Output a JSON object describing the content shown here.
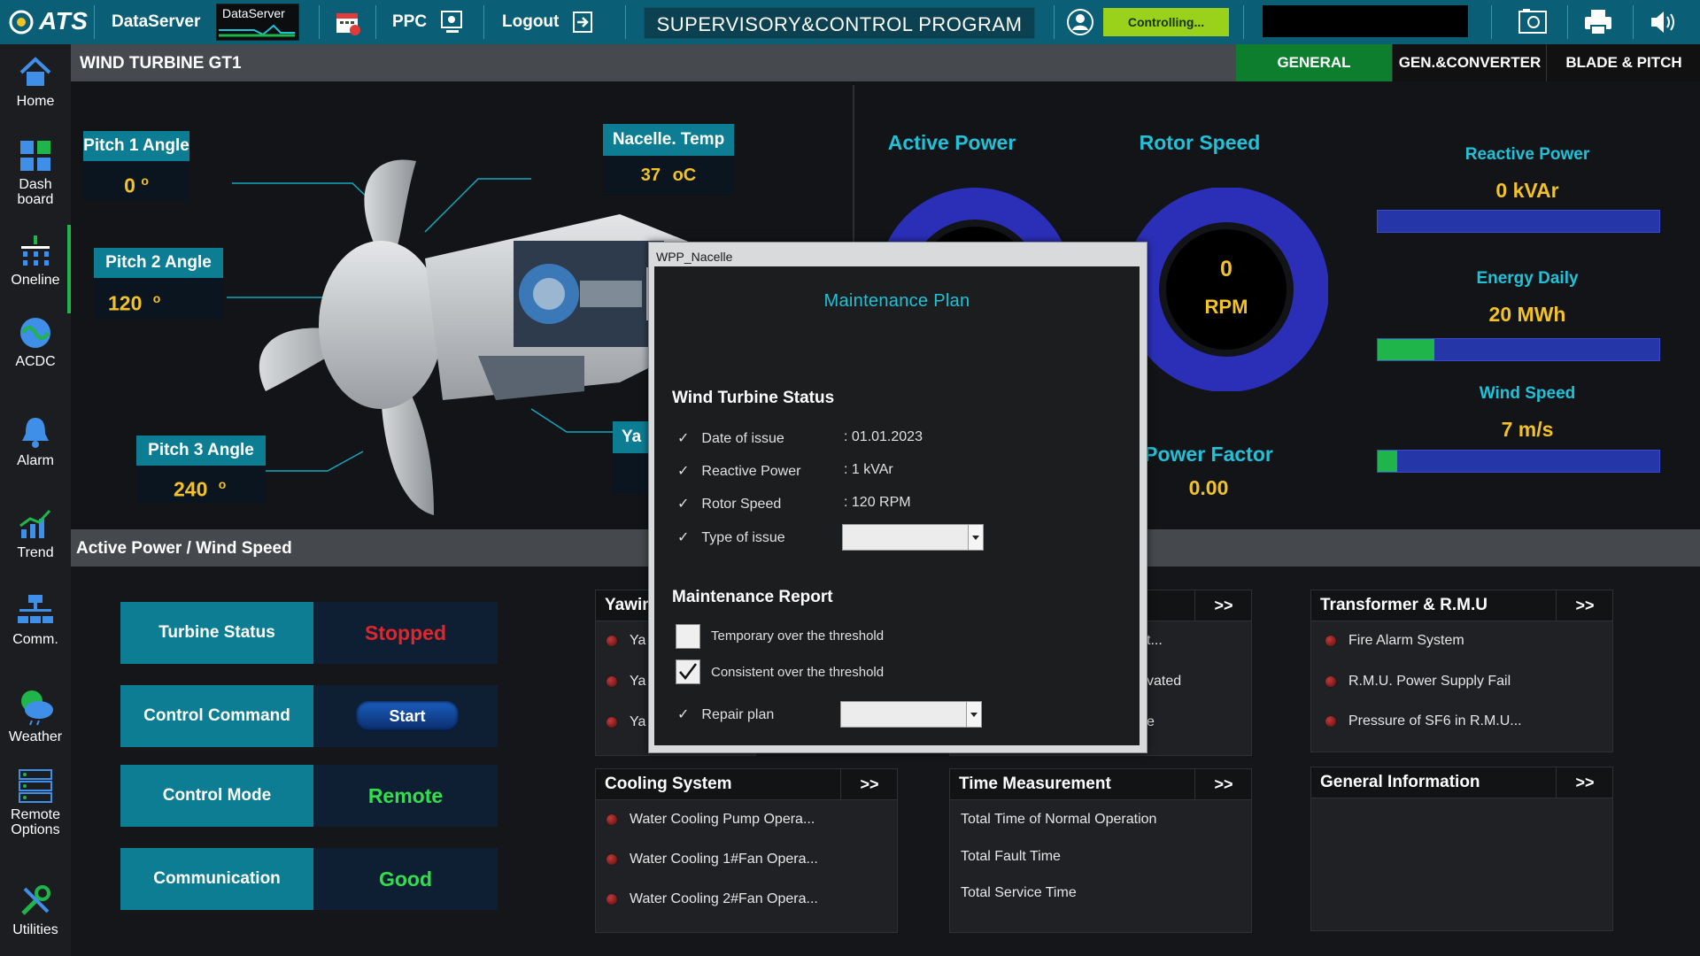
{
  "topbar": {
    "logo": "ATS",
    "dataserver_label": "DataServer",
    "dataserver_widget_label": "DataServer",
    "ppc_label": "PPC",
    "logout_label": "Logout",
    "program_title": "SUPERVISORY&CONTROL PROGRAM",
    "status_badge": "Controlling..."
  },
  "sidebar": {
    "items": [
      {
        "label": "Home",
        "icon": "home-icon"
      },
      {
        "label": "Dash board",
        "icon": "dashboard-icon"
      },
      {
        "label": "Oneline",
        "icon": "oneline-icon"
      },
      {
        "label": "ACDC",
        "icon": "acdc-icon"
      },
      {
        "label": "Alarm",
        "icon": "alarm-bell-icon"
      },
      {
        "label": "Trend",
        "icon": "trend-icon"
      },
      {
        "label": "Comm.",
        "icon": "network-icon"
      },
      {
        "label": "Weather",
        "icon": "weather-icon"
      },
      {
        "label": "Remote Options",
        "icon": "remote-options-icon"
      },
      {
        "label": "Utilities",
        "icon": "tools-icon"
      }
    ]
  },
  "header": {
    "title": "WIND TURBINE  GT1",
    "tabs": [
      {
        "label": "GENERAL",
        "active": true
      },
      {
        "label": "GEN.&CONVERTER",
        "active": false
      },
      {
        "label": "BLADE & PITCH",
        "active": false
      }
    ]
  },
  "turbine": {
    "pitch1": {
      "label": "Pitch 1 Angle",
      "value": "0",
      "unit": "o"
    },
    "pitch2": {
      "label": "Pitch 2 Angle",
      "value": "120",
      "unit": "o"
    },
    "pitch3": {
      "label": "Pitch 3 Angle",
      "value": "240",
      "unit": "o"
    },
    "nacelle_temp": {
      "label": "Nacelle. Temp",
      "value": "37",
      "unit": "oC"
    },
    "yaw_label_partial": "Ya"
  },
  "gauges": {
    "active_power_label": "Active Power",
    "rotor_speed_label": "Rotor Speed",
    "rotor_speed_value": "0",
    "rotor_speed_unit": "RPM",
    "power_factor_label": "Power Factor",
    "power_factor_value": "0.00"
  },
  "right_metrics": {
    "reactive_power": {
      "label": "Reactive Power",
      "value": "0",
      "unit": "kVAr",
      "fill_fraction": 0.0
    },
    "energy_daily": {
      "label": "Energy Daily",
      "value": "20",
      "unit": "MWh",
      "fill_fraction": 0.2
    },
    "wind_speed": {
      "label": "Wind Speed",
      "value": "7",
      "unit": "m/s",
      "fill_fraction": 0.07
    }
  },
  "section_title": "Active Power / Wind Speed",
  "status_tiles": [
    {
      "label": "Turbine Status",
      "value": "Stopped",
      "color": "#e0252b"
    },
    {
      "label": "Control Command",
      "value": "Start",
      "color": "#ffffff"
    },
    {
      "label": "Control Mode",
      "value": "Remote",
      "color": "#2fe04c"
    },
    {
      "label": "Communication",
      "value": "Good",
      "color": "#2fe04c"
    }
  ],
  "panels": {
    "yawing": {
      "title_partial": "Yawir",
      "rows_partial": [
        "Ya",
        "Ya",
        "Ya"
      ]
    },
    "middle_top": {
      "more": ">>",
      "rows_partial": [
        "t...",
        "vated",
        "e"
      ]
    },
    "transformer": {
      "title": "Transformer & R.M.U",
      "more": ">>",
      "rows": [
        "Fire Alarm System",
        "R.M.U. Power Supply Fail",
        "Pressure of SF6 in R.M.U..."
      ]
    },
    "cooling": {
      "title": "Cooling System",
      "more": ">>",
      "rows": [
        "Water Cooling Pump Opera...",
        "Water Cooling 1#Fan Opera...",
        "Water Cooling 2#Fan Opera..."
      ]
    },
    "time": {
      "title": "Time Measurement",
      "more": ">>",
      "rows": [
        "Total Time of Normal Operation",
        "Total Fault Time",
        "Total Service Time"
      ]
    },
    "general_info": {
      "title": "General Information",
      "more": ">>"
    }
  },
  "dialog": {
    "window_title": "WPP_Nacelle",
    "heading": "Maintenance Plan",
    "status_heading": "Wind Turbine Status",
    "status_rows": [
      {
        "label": "Date of issue",
        "value": ": 01.01.2023"
      },
      {
        "label": "Reactive Power",
        "value": ": 1 kVAr"
      },
      {
        "label": "Rotor Speed",
        "value": ": 120 RPM"
      },
      {
        "label": "Type of issue",
        "value": ""
      }
    ],
    "report_heading": "Maintenance Report",
    "checkboxes": [
      {
        "label": "Temporary over the threshold",
        "checked": false
      },
      {
        "label": "Consistent over the threshold",
        "checked": true
      }
    ],
    "repair_plan_label": "Repair plan"
  }
}
